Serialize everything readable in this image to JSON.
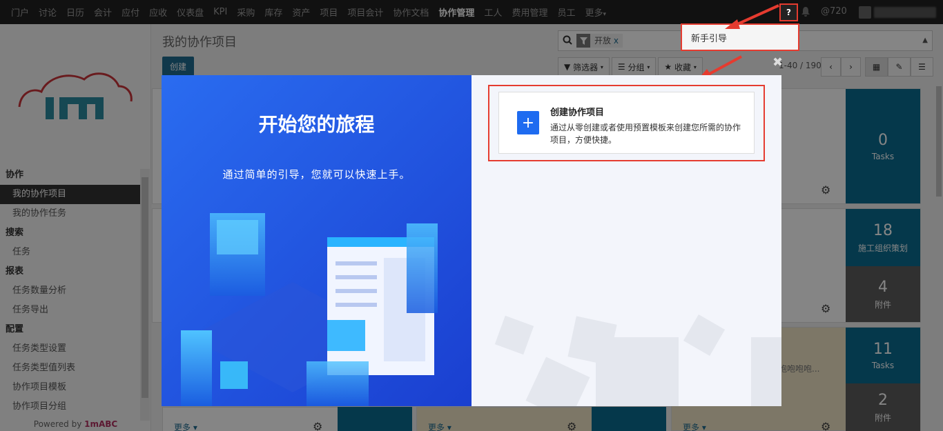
{
  "topnav": {
    "items": [
      "门户",
      "讨论",
      "日历",
      "会计",
      "应付",
      "应收",
      "仪表盘",
      "KPI",
      "采购",
      "库存",
      "资产",
      "项目",
      "项目会计",
      "协作文档",
      "协作管理",
      "工人",
      "费用管理",
      "员工",
      "更多"
    ],
    "active": "协作管理",
    "more_caret": "▾",
    "help": "?",
    "at_count": "@720"
  },
  "sidebar": {
    "sections": [
      {
        "title": "协作",
        "items": [
          "我的协作项目",
          "我的协作任务"
        ]
      },
      {
        "title": "搜索",
        "items": [
          "任务"
        ]
      },
      {
        "title": "报表",
        "items": [
          "任务数量分析",
          "任务导出"
        ]
      },
      {
        "title": "配置",
        "items": [
          "任务类型设置",
          "任务类型值列表",
          "协作项目模板",
          "协作项目分组"
        ]
      }
    ],
    "active_item": "我的协作项目",
    "powered_prefix": "Powered by ",
    "powered_brand": "1mABC"
  },
  "header": {
    "page_title": "我的协作项目",
    "create": "创建",
    "facet": "开放",
    "facet_remove": "x",
    "filters": "筛选器",
    "group": "分组",
    "favorites": "收藏",
    "pager": "1-40 / 190"
  },
  "cards": [
    {
      "num": "0",
      "lbl": "Tasks"
    },
    {
      "num": "18",
      "lbl": "施工组织策划"
    },
    {
      "num": "4",
      "lbl": "附件"
    },
    {
      "num": "11",
      "lbl": "Tasks"
    },
    {
      "num": "2",
      "lbl": "附件"
    }
  ],
  "card_text": "咆咆咆咆...",
  "more_label": "更多",
  "guide_dropdown": {
    "label": "新手引导"
  },
  "modal": {
    "title": "开始您的旅程",
    "subtitle": "通过简单的引导，您就可以快速上手。",
    "action": {
      "title": "创建协作项目",
      "desc": "通过从零创建或者使用预置模板来创建您所需的协作项目，方便快捷。"
    }
  },
  "colors": {
    "accent": "#1f6b91",
    "highlight": "#e53b2f",
    "modal_blue": "#2a6cf0"
  }
}
